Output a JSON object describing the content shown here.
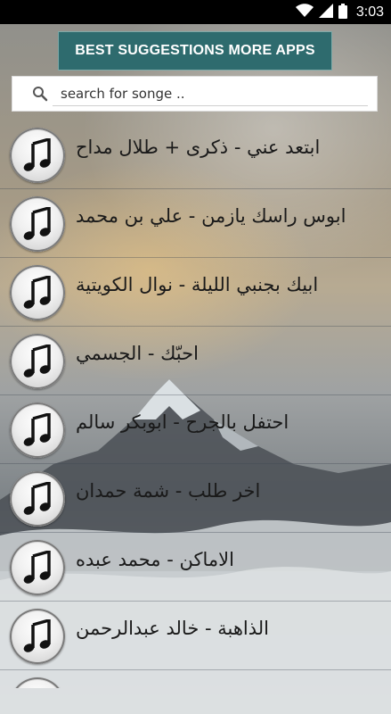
{
  "status_bar": {
    "time": "3:03",
    "icons": [
      "wifi-icon",
      "signal-icon",
      "battery-icon"
    ]
  },
  "top_button": {
    "label": "BEST SUGGESTIONS MORE APPS",
    "color": "#2e6b6e"
  },
  "search": {
    "placeholder": "search for songe ..",
    "value": ""
  },
  "songs": [
    {
      "title": "ابتعد عني - ذكرى + طلال مداح",
      "icon": "music-note-icon"
    },
    {
      "title": "ابوس راسك يازمن - علي بن محمد",
      "icon": "music-note-icon"
    },
    {
      "title": "ابيك بجنبي الليلة - نوال الكويتية",
      "icon": "music-note-icon"
    },
    {
      "title": "احبّك - الجسمي",
      "icon": "music-note-icon"
    },
    {
      "title": "احتفل بالجرح - ابوبكر سالم",
      "icon": "music-note-icon"
    },
    {
      "title": "اخر طلب - شمة حمدان",
      "icon": "music-note-icon"
    },
    {
      "title": "الاماكن - محمد عبده",
      "icon": "music-note-icon"
    },
    {
      "title": "الذاهبة - خالد عبدالرحمن",
      "icon": "music-note-icon"
    }
  ]
}
